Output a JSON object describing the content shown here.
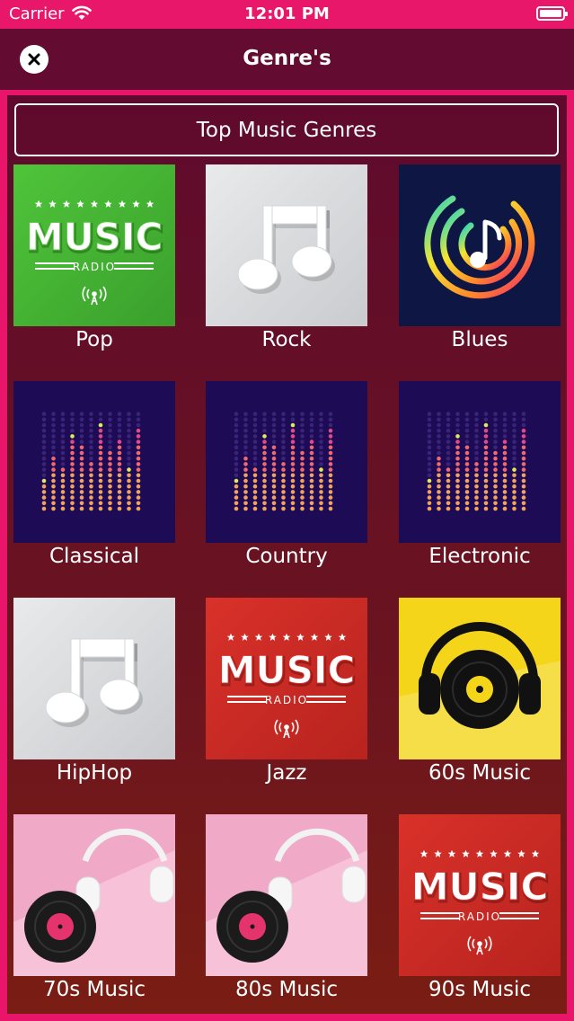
{
  "status_bar": {
    "carrier": "Carrier",
    "time": "12:01 PM"
  },
  "nav": {
    "title": "Genre's",
    "close_icon": "close-icon"
  },
  "header_button": "Top Music Genres",
  "genres": [
    {
      "label": "Pop",
      "art": "music-radio-green"
    },
    {
      "label": "Rock",
      "art": "music-note-grey"
    },
    {
      "label": "Blues",
      "art": "note-rings-navy"
    },
    {
      "label": "Classical",
      "art": "equalizer-purple"
    },
    {
      "label": "Country",
      "art": "equalizer-purple"
    },
    {
      "label": "Electronic",
      "art": "equalizer-purple"
    },
    {
      "label": "HipHop",
      "art": "music-note-grey"
    },
    {
      "label": "Jazz",
      "art": "music-radio-red"
    },
    {
      "label": "60s Music",
      "art": "headphones-vinyl-yellow"
    },
    {
      "label": "70s Music",
      "art": "vinyl-headphones-pink"
    },
    {
      "label": "80s Music",
      "art": "vinyl-headphones-pink"
    },
    {
      "label": "90s Music",
      "art": "music-radio-red"
    }
  ],
  "art_text": {
    "music": "MUSIC",
    "radio": "RADIO"
  },
  "colors": {
    "status_bar": "#e8176a",
    "nav_bar": "#640b31",
    "border": "#e8156a"
  }
}
